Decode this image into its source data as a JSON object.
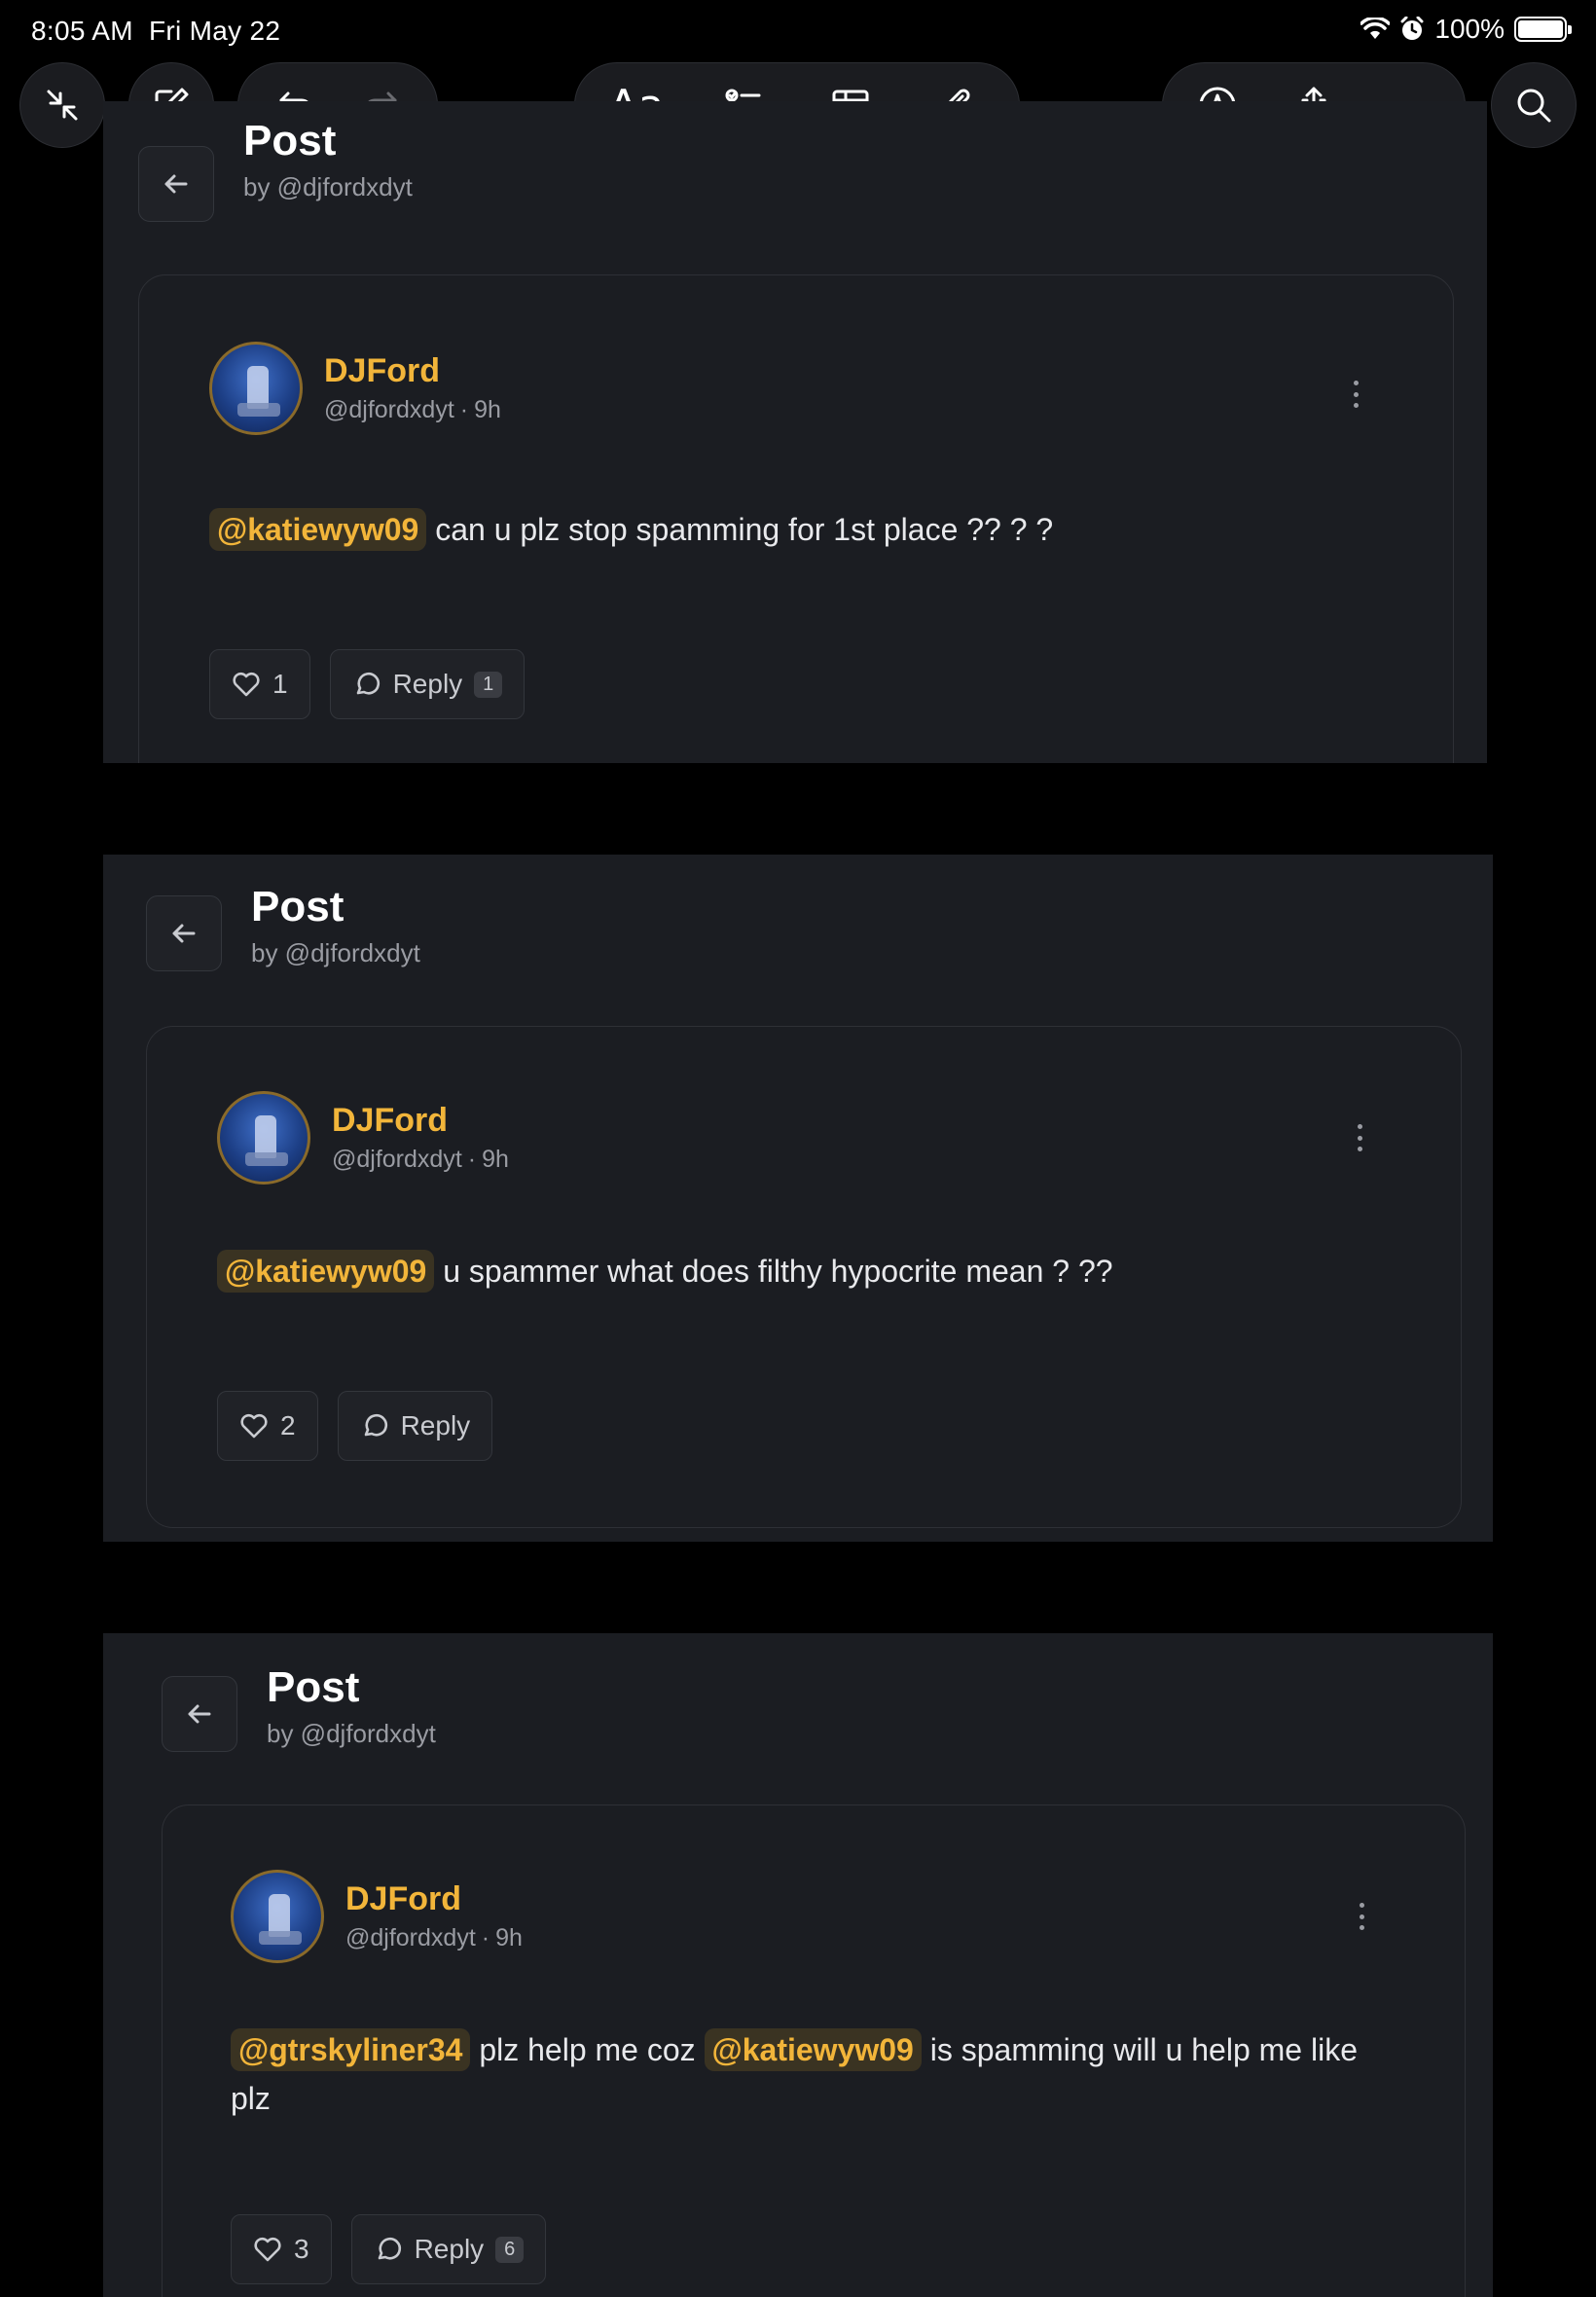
{
  "status_bar": {
    "time": "8:05 AM",
    "date": "Fri May 22",
    "battery": "100%",
    "icons": [
      "wifi-icon",
      "alarm-icon",
      "battery-icon"
    ]
  },
  "toolbar": {
    "left": [
      "collapse-icon",
      "compose-icon",
      "undo-icon",
      "redo-icon"
    ],
    "center": [
      "text-format-icon",
      "checklist-icon",
      "table-icon",
      "attachment-icon"
    ],
    "text_format_label": "Aa",
    "right": [
      "markup-icon",
      "share-icon",
      "more-icon"
    ],
    "search": "search-icon"
  },
  "posts": [
    {
      "header_title": "Post",
      "header_sub": "by @djfordxdyt",
      "author_name": "DJFord",
      "author_handle": "@djfordxdyt",
      "author_time": "9h",
      "body": [
        {
          "mention": "@katiewyw09"
        },
        {
          "text": "can u plz stop spamming for 1st place ?? ? ?"
        }
      ],
      "likes": "1",
      "reply_label": "Reply",
      "reply_count": "1"
    },
    {
      "header_title": "Post",
      "header_sub": "by @djfordxdyt",
      "author_name": "DJFord",
      "author_handle": "@djfordxdyt",
      "author_time": "9h",
      "body": [
        {
          "mention": "@katiewyw09"
        },
        {
          "text": "u spammer what does filthy hypocrite mean ? ??"
        }
      ],
      "likes": "2",
      "reply_label": "Reply",
      "reply_count": ""
    },
    {
      "header_title": "Post",
      "header_sub": "by @djfordxdyt",
      "author_name": "DJFord",
      "author_handle": "@djfordxdyt",
      "author_time": "9h",
      "body": [
        {
          "mention": "@gtrskyliner34"
        },
        {
          "text": "plz help me coz"
        },
        {
          "mention": "@katiewyw09"
        },
        {
          "text": "is spamming will u help me like plz"
        }
      ],
      "likes": "3",
      "reply_label": "Reply",
      "reply_count": "6"
    }
  ]
}
